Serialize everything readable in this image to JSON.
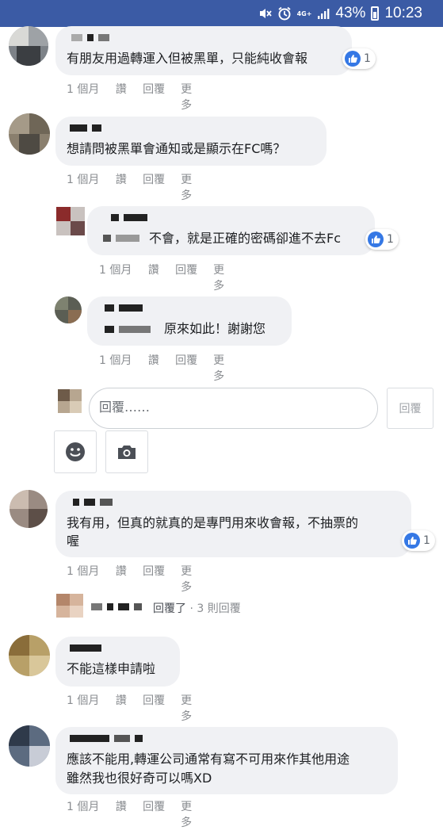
{
  "status_bar": {
    "network": "4G+",
    "battery": "43%",
    "time": "10:23"
  },
  "comments": [
    {
      "text": "有朋友用過轉運入但被黑單，只能純收會報",
      "likes": "1",
      "time": "1 個月",
      "like": "讚",
      "reply": "回覆",
      "more": "更多"
    },
    {
      "text": "想請問被黑單會通知或是顯示在FC嗎？",
      "time": "1 個月",
      "like": "讚",
      "reply": "回覆",
      "more": "更多"
    },
    {
      "text": "不會，就是正確的密碼卻進不去Fc",
      "likes": "1",
      "time": "1 個月",
      "like": "讚",
      "reply": "回覆",
      "more": "更多"
    },
    {
      "text": "原來如此！謝謝您",
      "time": "1 個月",
      "like": "讚",
      "reply": "回覆",
      "more": "更多"
    },
    {
      "text_line1": "我有用，但真的就真的是專門用來收會報，不抽票的",
      "text_line2": "喔",
      "likes": "1",
      "time": "1 個月",
      "like": "讚",
      "reply": "回覆",
      "more": "更多"
    },
    {
      "text": "不能這樣申請啦",
      "time": "1 個月",
      "like": "讚",
      "reply": "回覆",
      "more": "更多"
    },
    {
      "text_line1": "應該不能用,轉運公司通常有寫不可用來作其他用途",
      "text_line2": "雖然我也很好奇可以嗎XD",
      "time": "1 個月",
      "like": "讚",
      "reply": "回覆",
      "more": "更多"
    }
  ],
  "reply_composer": {
    "placeholder": "回覆……",
    "submit_label": "回覆",
    "emoji_icon": "smiley-icon",
    "camera_icon": "camera-icon"
  },
  "replies_summary": {
    "action": "回覆了",
    "count": "· 3 則回覆"
  },
  "colors": {
    "status_bar": "#3b5ba5",
    "bubble": "#f0f1f4",
    "like_blue": "#3578e5",
    "meta_gray": "#8a8d91"
  }
}
